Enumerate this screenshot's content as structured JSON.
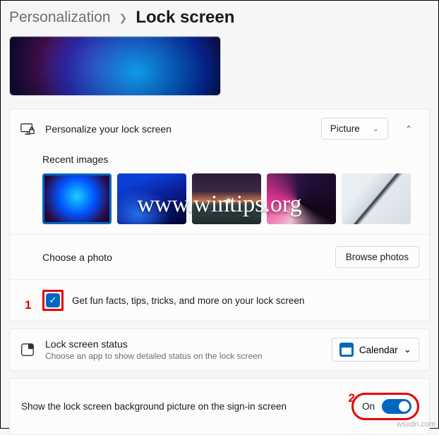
{
  "breadcrumb": {
    "parent": "Personalization",
    "current": "Lock screen"
  },
  "personalize": {
    "label": "Personalize your lock screen",
    "dropdown_value": "Picture",
    "recent_label": "Recent images",
    "choose_label": "Choose a photo",
    "browse_label": "Browse photos",
    "fun_facts_label": "Get fun facts, tips, tricks, and more on your lock screen",
    "fun_facts_checked": true
  },
  "status": {
    "title": "Lock screen status",
    "subtitle": "Choose an app to show detailed status on the lock screen",
    "app": "Calendar"
  },
  "signin": {
    "label": "Show the lock screen background picture on the sign-in screen",
    "toggle_text": "On",
    "toggle_on": true
  },
  "markers": {
    "one": "1",
    "two": "2"
  },
  "watermark": "www.wintips.org",
  "attribution": "wsxdn.com"
}
